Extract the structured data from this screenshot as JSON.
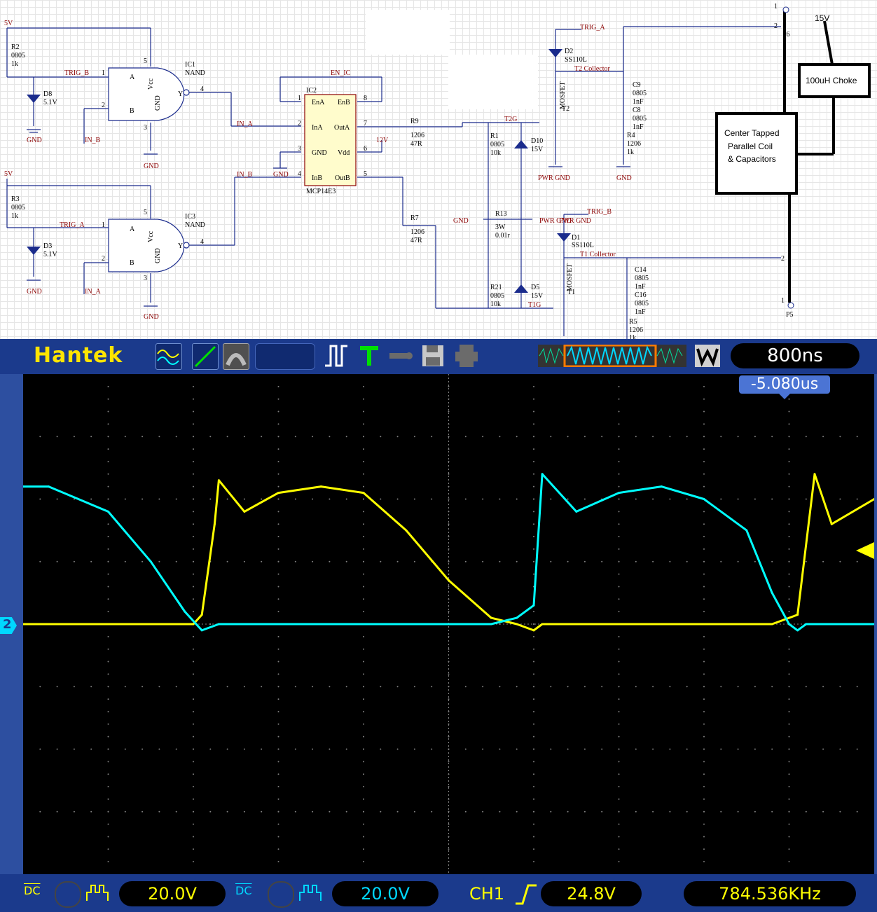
{
  "schematic": {
    "ic1": {
      "ref": "IC1",
      "type": "NAND",
      "pinA": "A",
      "pinB": "B",
      "vcc": "Vcc",
      "gnd": "GND",
      "out": "Y",
      "n1": "1",
      "n2": "2",
      "n3": "3",
      "n4": "4",
      "n5": "5"
    },
    "ic3": {
      "ref": "IC3",
      "type": "NAND",
      "pinA": "A",
      "pinB": "B",
      "vcc": "Vcc",
      "gnd": "GND",
      "out": "Y",
      "n1": "1",
      "n2": "2",
      "n3": "3",
      "n4": "4",
      "n5": "5"
    },
    "ic2": {
      "ref": "IC2",
      "part": "MCP14E3",
      "pins": [
        "EnA",
        "EnB",
        "InA",
        "OutA",
        "GND",
        "Vdd",
        "InB",
        "OutB"
      ],
      "nums": [
        "1",
        "8",
        "2",
        "7",
        "3",
        "6",
        "4",
        "5"
      ]
    },
    "nets": {
      "v5": "5V",
      "trig_b": "TRIG_B",
      "trig_a": "TRIG_A",
      "in_a": "IN_A",
      "in_b": "IN_B",
      "en_ic": "EN_IC",
      "v12": "12V",
      "gnd": "GND",
      "pwr_gnd": "PWR GND",
      "t2g": "T2G",
      "t1g": "T1G",
      "t2c": "T2 Collector",
      "t1c": "T1 Collector",
      "v15": "15V"
    },
    "parts": {
      "r2": [
        "R2",
        "0805",
        "1k"
      ],
      "r3": [
        "R3",
        "0805",
        "1k"
      ],
      "d8": [
        "D8",
        "5.1V"
      ],
      "d3": [
        "D3",
        "5.1V"
      ],
      "r9": [
        "R9",
        "1206",
        "47R"
      ],
      "r7": [
        "R7",
        "1206",
        "47R"
      ],
      "r1": [
        "R1",
        "0805",
        "10k"
      ],
      "r21": [
        "R21",
        "0805",
        "10k"
      ],
      "r13": [
        "R13",
        "3W",
        "0.01r"
      ],
      "d10": [
        "D10",
        "15V"
      ],
      "d5": [
        "D5",
        "15V"
      ],
      "d2": [
        "D2",
        "SS110L"
      ],
      "d1": [
        "D1",
        "SS110L"
      ],
      "t2": [
        "T2",
        "MOSFET"
      ],
      "t1": [
        "T1",
        "MOSFET"
      ],
      "c9": [
        "C9",
        "0805",
        "1nF"
      ],
      "c8": [
        "C8",
        "0805",
        "1nF"
      ],
      "c14": [
        "C14",
        "0805",
        "1nF"
      ],
      "c16": [
        "C16",
        "0805",
        "1nF"
      ],
      "r4": [
        "R4",
        "1206",
        "1k"
      ],
      "r5": [
        "R5",
        "1206",
        "1k"
      ],
      "p6": [
        "P6",
        "1",
        "2"
      ],
      "p5": [
        "P5",
        "1",
        "2"
      ]
    },
    "choke_label": "100uH Choke",
    "coil_label_1": "Center Tapped",
    "coil_label_2": "Parallel Coil",
    "coil_label_3": "& Capacitors"
  },
  "scope": {
    "brand": "Hantek",
    "timebase": "800ns",
    "trigger_offset": "-5.080us",
    "channel_marker": "2",
    "ch1": {
      "coupling": "DC",
      "volts_div": "20.0V"
    },
    "ch2": {
      "coupling": "DC",
      "volts_div": "20.0V"
    },
    "trigger": {
      "source": "CH1",
      "level": "24.8V"
    },
    "frequency": "784.536KHz",
    "colors": {
      "ch1": "#ffff00",
      "ch2": "#00ffff",
      "grid": "#808080",
      "accent": "#ff7a00"
    }
  },
  "chart_data": {
    "type": "line",
    "x_unit": "div",
    "y_unit": "div",
    "xlim": [
      0,
      10
    ],
    "ylim": [
      -4,
      4
    ],
    "series": [
      {
        "color": "#ffff00",
        "x": [
          0,
          0.5,
          1,
          1.5,
          2,
          2.1,
          2.25,
          2.3,
          2.6,
          3,
          3.5,
          4,
          4.5,
          5,
          5.5,
          5.8,
          6,
          6.1,
          6.5,
          7,
          7.5,
          8,
          8.5,
          8.8,
          9,
          9.1,
          9.3,
          9.5,
          10
        ],
        "y": [
          0,
          0,
          0,
          0,
          0,
          0.15,
          1.6,
          2.3,
          1.8,
          2.1,
          2.2,
          2.1,
          1.5,
          0.7,
          0.1,
          0,
          -0.1,
          0,
          0,
          0,
          0,
          0,
          0,
          0,
          0.1,
          0.15,
          2.4,
          1.6,
          2.0
        ]
      },
      {
        "color": "#00ffff",
        "x": [
          0,
          0.3,
          1,
          1.5,
          1.9,
          2.1,
          2.3,
          2.6,
          3,
          3.5,
          4,
          4.5,
          5,
          5.5,
          5.8,
          6,
          6.1,
          6.5,
          7,
          7.5,
          8,
          8.5,
          8.8,
          9,
          9.1,
          9.2,
          9.5,
          10
        ],
        "y": [
          2.2,
          2.2,
          1.8,
          1.0,
          0.2,
          -0.1,
          0,
          0,
          0,
          0,
          0,
          0,
          0,
          0,
          0.1,
          0.3,
          2.4,
          1.8,
          2.1,
          2.2,
          2.0,
          1.5,
          0.5,
          0,
          -0.1,
          0,
          0,
          0
        ]
      }
    ]
  }
}
